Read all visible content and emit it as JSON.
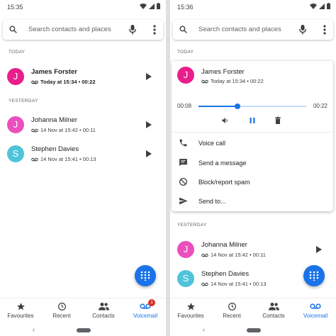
{
  "left": {
    "status_time": "15:35",
    "search_placeholder": "Search contacts and places",
    "today": "TODAY",
    "yesterday": "YESTERDAY",
    "calls": [
      {
        "initial": "J",
        "name": "James Forster",
        "meta": "Today at 15:34 • 00:22",
        "color": "#e91e8c"
      },
      {
        "initial": "J",
        "name": "Johanna Milner",
        "meta": "14 Nov at 15:42 • 00:11",
        "color": "#e94fbd"
      },
      {
        "initial": "S",
        "name": "Stephen Davies",
        "meta": "14 Nov at 15:41 • 00:13",
        "color": "#4fc3d9"
      }
    ]
  },
  "right": {
    "status_time": "15:36",
    "search_placeholder": "Search contacts and places",
    "today": "TODAY",
    "yesterday": "YESTERDAY",
    "expanded": {
      "initial": "J",
      "name": "James Forster",
      "meta": "Today at 15:34 • 00:22",
      "color": "#e91e8c",
      "position": "00:08",
      "duration": "00:22",
      "progress": 0.36,
      "actions": [
        "Voice call",
        "Send a message",
        "Block/report spam",
        "Send to..."
      ]
    },
    "calls": [
      {
        "initial": "J",
        "name": "Johanna Milner",
        "meta": "14 Nov at 15:42 • 00:11",
        "color": "#e94fbd"
      },
      {
        "initial": "S",
        "name": "Stephen Davies",
        "meta": "14 Nov at 15:41 • 00:13",
        "color": "#4fc3d9"
      }
    ]
  },
  "nav": {
    "favourites": "Favourites",
    "recent": "Recent",
    "contacts": "Contacts",
    "voicemail": "Voicemail",
    "voicemail_badge": "1"
  },
  "colors": {
    "accent": "#1a73e8",
    "badge": "#d93025"
  }
}
